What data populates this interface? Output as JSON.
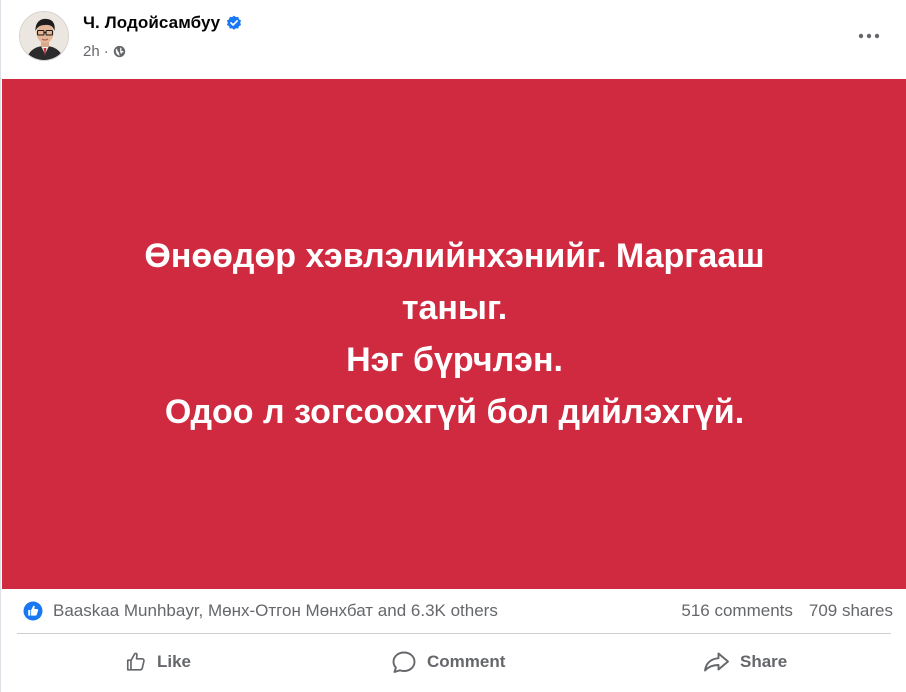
{
  "post": {
    "author": "Ч. Лодойсамбуу",
    "timestamp": "2h",
    "visibility_icon": "globe-icon",
    "verified_icon": "verified-badge-icon",
    "more_icon": "more-options-icon",
    "background_color": "#cf2a40",
    "text_lines": [
      "Өнөөдөр хэвлэлийнхэнийг. Маргааш",
      "таныг.",
      "Нэг бүрчлэн.",
      "Одоо л зогсоохгүй бол дийлэхгүй."
    ]
  },
  "reactions": {
    "reactors_text": "Baaskaa Munhbayr, Мөнх-Отгон Мөнхбат and 6.3K others",
    "comments_count": "516 comments",
    "shares_count": "709 shares",
    "reaction_icon": "like-reaction-icon"
  },
  "actions": {
    "like_label": "Like",
    "comment_label": "Comment",
    "share_label": "Share"
  },
  "colors": {
    "accent": "#1877f2",
    "secondary_text": "#65676b",
    "post_background": "#cf2a40"
  }
}
